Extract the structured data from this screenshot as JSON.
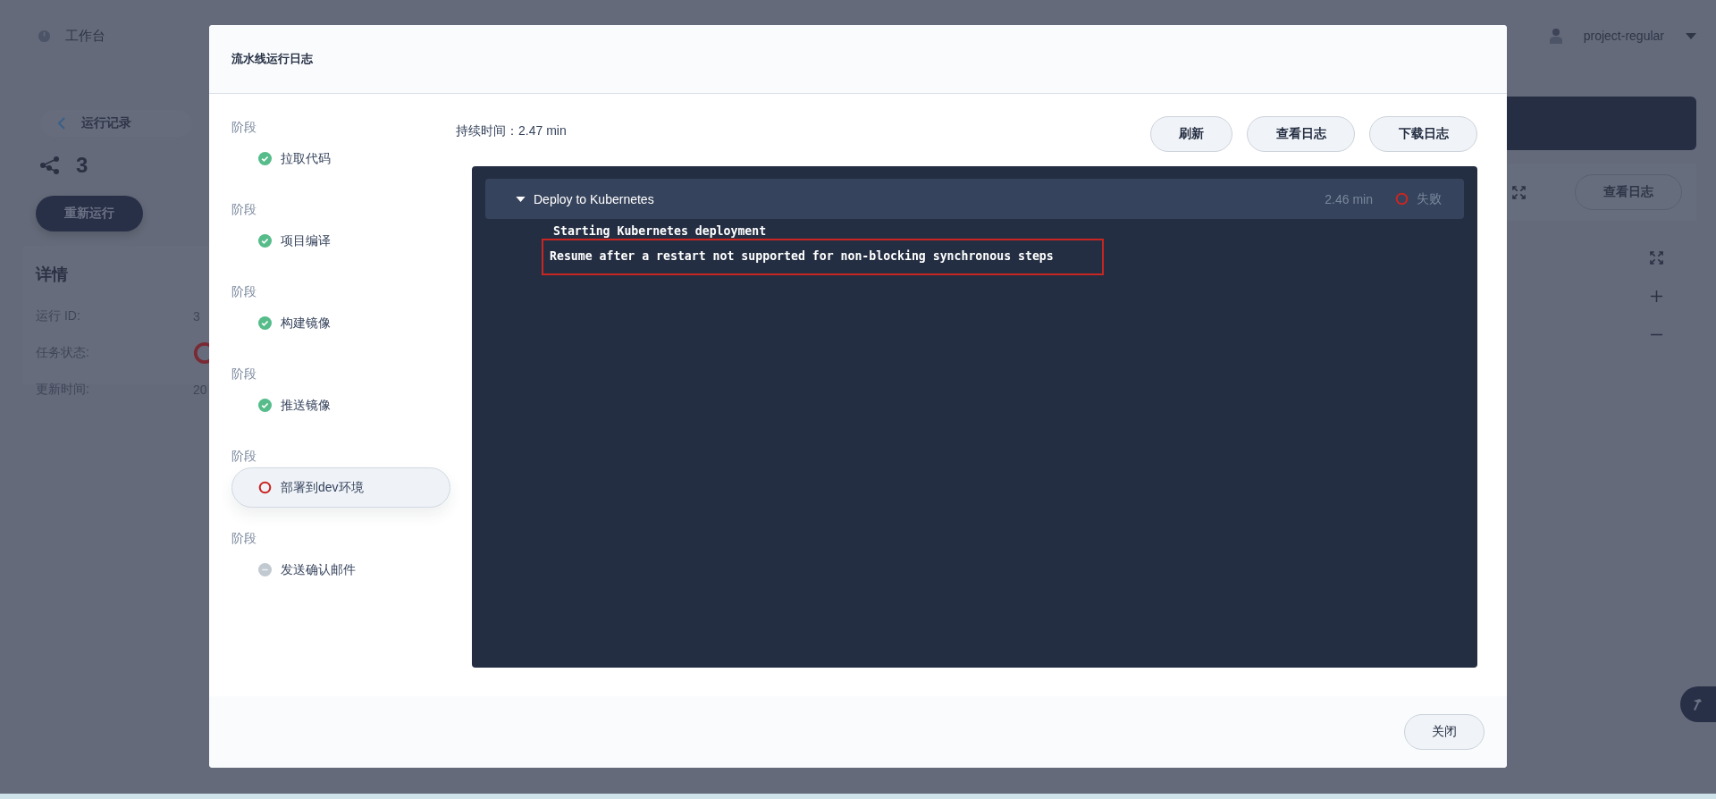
{
  "topbar": {
    "title": "工作台",
    "user": "project-regular"
  },
  "background": {
    "back_link": "运行记录",
    "run_number": "3",
    "rerun_button": "重新运行",
    "details": {
      "title": "详情",
      "rows": [
        {
          "label": "运行 ID:",
          "kind": "text",
          "value": "3"
        },
        {
          "label": "任务状态:",
          "kind": "failure"
        },
        {
          "label": "更新时间:",
          "kind": "text",
          "value": "20"
        }
      ]
    },
    "view_log_button": "查看日志"
  },
  "modal": {
    "title": "流水线运行日志",
    "stages": [
      {
        "heading": "阶段",
        "name": "拉取代码",
        "kind": "success",
        "selected": false
      },
      {
        "heading": "阶段",
        "name": "项目编译",
        "kind": "success",
        "selected": false
      },
      {
        "heading": "阶段",
        "name": "构建镜像",
        "kind": "success",
        "selected": false
      },
      {
        "heading": "阶段",
        "name": "推送镜像",
        "kind": "success",
        "selected": false
      },
      {
        "heading": "阶段",
        "name": "部署到dev环境",
        "kind": "failed",
        "selected": true
      },
      {
        "heading": "阶段",
        "name": "发送确认邮件",
        "kind": "pending",
        "selected": false
      }
    ],
    "duration": "持续时间：2.47 min",
    "buttons": [
      "刷新",
      "查看日志",
      "下载日志"
    ],
    "log": {
      "step": {
        "name": "Deploy to Kubernetes",
        "expanded": true,
        "duration": "2.46 min",
        "kind": "failed",
        "status_label": "失败"
      },
      "lines": [
        {
          "text": "Starting Kubernetes deployment",
          "highlighted": false
        },
        {
          "text": "Resume after a restart not supported for non-blocking synchronous steps",
          "highlighted": true
        }
      ]
    },
    "close_button": "关闭"
  }
}
